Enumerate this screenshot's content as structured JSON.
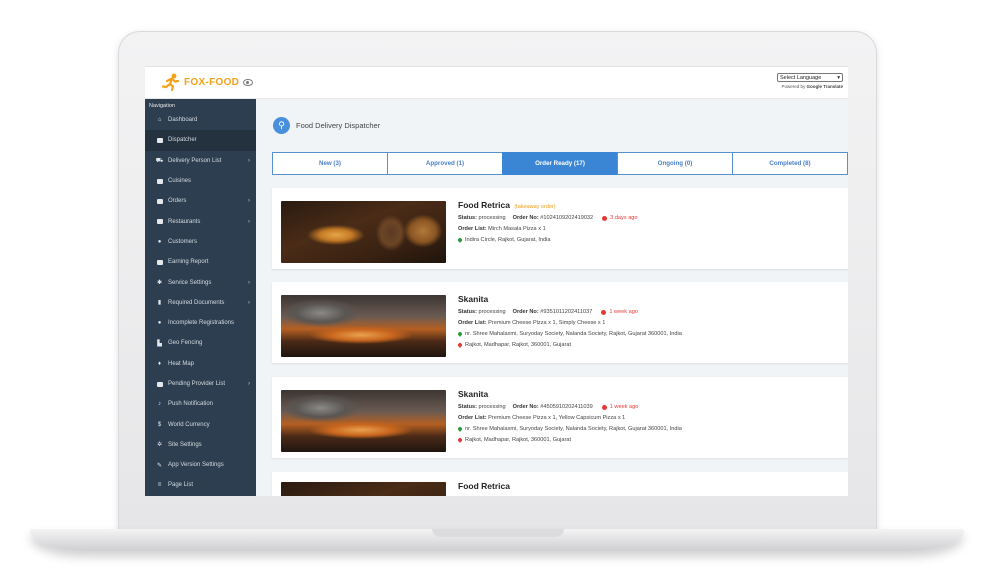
{
  "header": {
    "logo_text": "FOX-FOOD",
    "language_select": "Select Language",
    "powered_by": "Powered by",
    "google_translate": "Google Translate"
  },
  "sidebar": {
    "title": "Navigation",
    "items": [
      {
        "label": "Dashboard",
        "icon": "home-icon"
      },
      {
        "label": "Dispatcher",
        "icon": "dispatcher-icon"
      },
      {
        "label": "Delivery Person List",
        "icon": "motorbike-icon"
      },
      {
        "label": "Cuisines",
        "icon": "cuisine-icon"
      },
      {
        "label": "Orders",
        "icon": "orders-icon"
      },
      {
        "label": "Restaurants",
        "icon": "restaurant-icon"
      },
      {
        "label": "Customers",
        "icon": "user-icon"
      },
      {
        "label": "Earning Report",
        "icon": "report-icon"
      },
      {
        "label": "Service Settings",
        "icon": "gear-icon"
      },
      {
        "label": "Required Documents",
        "icon": "document-icon"
      },
      {
        "label": "Incomplete Registrations",
        "icon": "user-plus-icon"
      },
      {
        "label": "Geo Fencing",
        "icon": "map-icon"
      },
      {
        "label": "Heat Map",
        "icon": "pin-icon"
      },
      {
        "label": "Pending Provider List",
        "icon": "provider-icon"
      },
      {
        "label": "Push Notification",
        "icon": "bell-icon"
      },
      {
        "label": "World Currency",
        "icon": "dollar-icon"
      },
      {
        "label": "Site Settings",
        "icon": "gears-icon"
      },
      {
        "label": "App Version Settings",
        "icon": "wrench-icon"
      },
      {
        "label": "Page List",
        "icon": "list-icon"
      }
    ]
  },
  "page": {
    "title": "Food Delivery Dispatcher"
  },
  "tabs": [
    {
      "label": "New (3)"
    },
    {
      "label": "Approved (1)"
    },
    {
      "label": "Order Ready (17)"
    },
    {
      "label": "Ongoing (0)"
    },
    {
      "label": "Completed (8)"
    }
  ],
  "orders": [
    {
      "name": "Food Retrica",
      "tag": "(takeaway order)",
      "status_label": "Status:",
      "status": "processing",
      "order_no_label": "Order No:",
      "order_no": "#1024109202419032",
      "time_ago": "3 days ago",
      "order_list_label": "Order List:",
      "order_list": "Mirch Masala Pizza x 1",
      "pickup": "Indira Circle, Rajkot, Gujarat, India"
    },
    {
      "name": "Skanita",
      "status_label": "Status:",
      "status": "processing",
      "order_no_label": "Order No:",
      "order_no": "#9351011202411037",
      "time_ago": "1 week ago",
      "order_list_label": "Order List:",
      "order_list": "Premium Cheese Pizza x 1, Simply Cheese x 1",
      "pickup": "nr. Shree Mahalaxmi, Suryoday Society, Nalanda Society, Rajkot, Gujarat 360001, India",
      "dropoff": "Rajkot, Madhapar, Rajkot, 360001, Gujarat"
    },
    {
      "name": "Skanita",
      "status_label": "Status:",
      "status": "processing",
      "order_no_label": "Order No:",
      "order_no": "#4505910202411039",
      "time_ago": "1 week ago",
      "order_list_label": "Order List:",
      "order_list": "Premium Cheese Pizza x 1, Yellow Capsicum Pizza x 1",
      "pickup": "nr. Shree Mahalaxmi, Suryoday Society, Nalanda Society, Rajkot, Gujarat 360001, India",
      "dropoff": "Rajkot, Madhapar, Rajkot, 360001, Gujarat"
    },
    {
      "name": "Food Retrica"
    }
  ],
  "colors": {
    "brand": "#f3a11a",
    "sidebar": "#2c3e50",
    "accent": "#3a86d4",
    "danger": "#e53935",
    "pickup_pin": "#2e9b3a"
  }
}
